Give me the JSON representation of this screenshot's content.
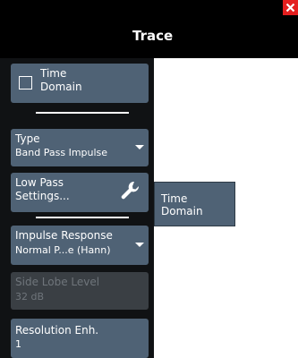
{
  "window": {
    "title": "Trace",
    "close_icon": "close-icon"
  },
  "softkeys": {
    "time_domain": {
      "line1": "Time",
      "line2": "Domain",
      "checked": false
    },
    "type": {
      "label": "Type",
      "value": "Band Pass Impulse"
    },
    "low_pass": {
      "line1": "Low Pass",
      "line2": "Settings...",
      "icon": "wrench-icon"
    },
    "impulse": {
      "label": "Impulse Response",
      "value": "Normal P...e (Hann)"
    },
    "side_lobe": {
      "label": "Side Lobe Level",
      "value": "32 dB",
      "enabled": false
    },
    "resolution": {
      "label": "Resolution Enh.",
      "value": "1"
    }
  },
  "popup": {
    "line1": "Time",
    "line2": "Domain"
  },
  "colors": {
    "softkey_bg": "#4f6275",
    "panel_bg": "#101214",
    "titlebar_bg": "#000000",
    "close_bg": "#e41f1f",
    "disabled_text": "#6f757b"
  }
}
